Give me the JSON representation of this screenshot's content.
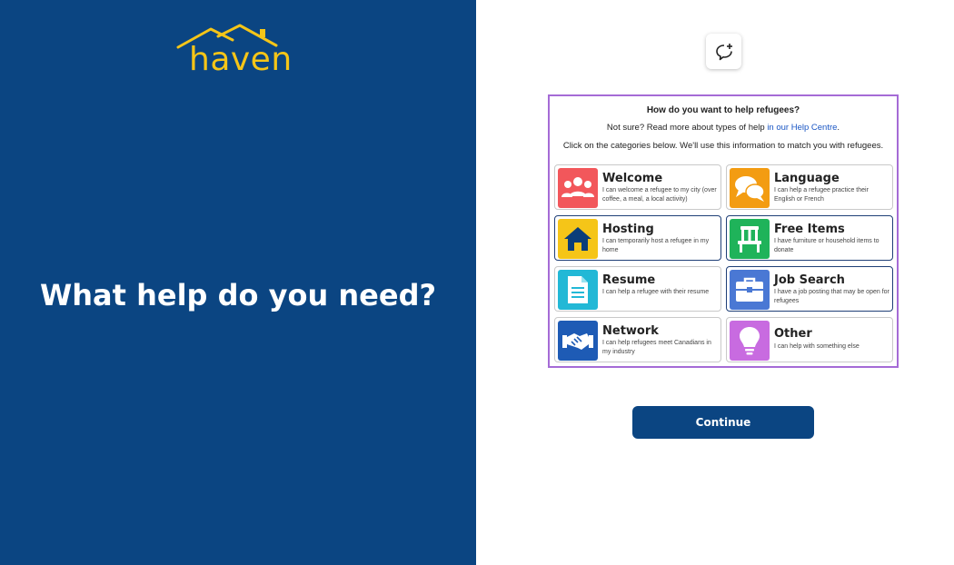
{
  "brand": {
    "name": "haven"
  },
  "hero": {
    "title": "What help do you need?"
  },
  "form": {
    "question": "How do you want to help refugees?",
    "help_prefix": "Not sure? Read more about types of help ",
    "help_link": "in our Help Centre",
    "help_suffix": ".",
    "instructions": "Click on the categories below. We'll use this information to match you with refugees.",
    "categories": [
      {
        "title": "Welcome",
        "description": "I can welcome a refugee to my city (over coffee, a meal, a local activity)",
        "icon": "people-icon",
        "color": "#f2575b",
        "selected": false
      },
      {
        "title": "Language",
        "description": "I can help a refugee practice their English or French",
        "icon": "chat-bubbles-icon",
        "color": "#f39c12",
        "selected": false
      },
      {
        "title": "Hosting",
        "description": "I can temporarily host a refugee in my home",
        "icon": "house-icon",
        "color": "#f5c518",
        "selected": true
      },
      {
        "title": "Free Items",
        "description": "I have furniture or household items to donate",
        "icon": "chair-icon",
        "color": "#1fb35a",
        "selected": true
      },
      {
        "title": "Resume",
        "description": "I can help a refugee with their resume",
        "icon": "document-icon",
        "color": "#22b8d6",
        "selected": false
      },
      {
        "title": "Job Search",
        "description": "I have a job posting that may be open for refugees",
        "icon": "briefcase-icon",
        "color": "#4a78d4",
        "selected": true
      },
      {
        "title": "Network",
        "description": "I can help refugees meet Canadians in my industry",
        "icon": "handshake-icon",
        "color": "#1e5bb5",
        "selected": false
      },
      {
        "title": "Other",
        "description": "I can help with something else",
        "icon": "lightbulb-icon",
        "color": "#c86be0",
        "selected": false
      }
    ]
  },
  "actions": {
    "continue_label": "Continue"
  },
  "icons": {
    "chat": "chat-add-icon"
  }
}
